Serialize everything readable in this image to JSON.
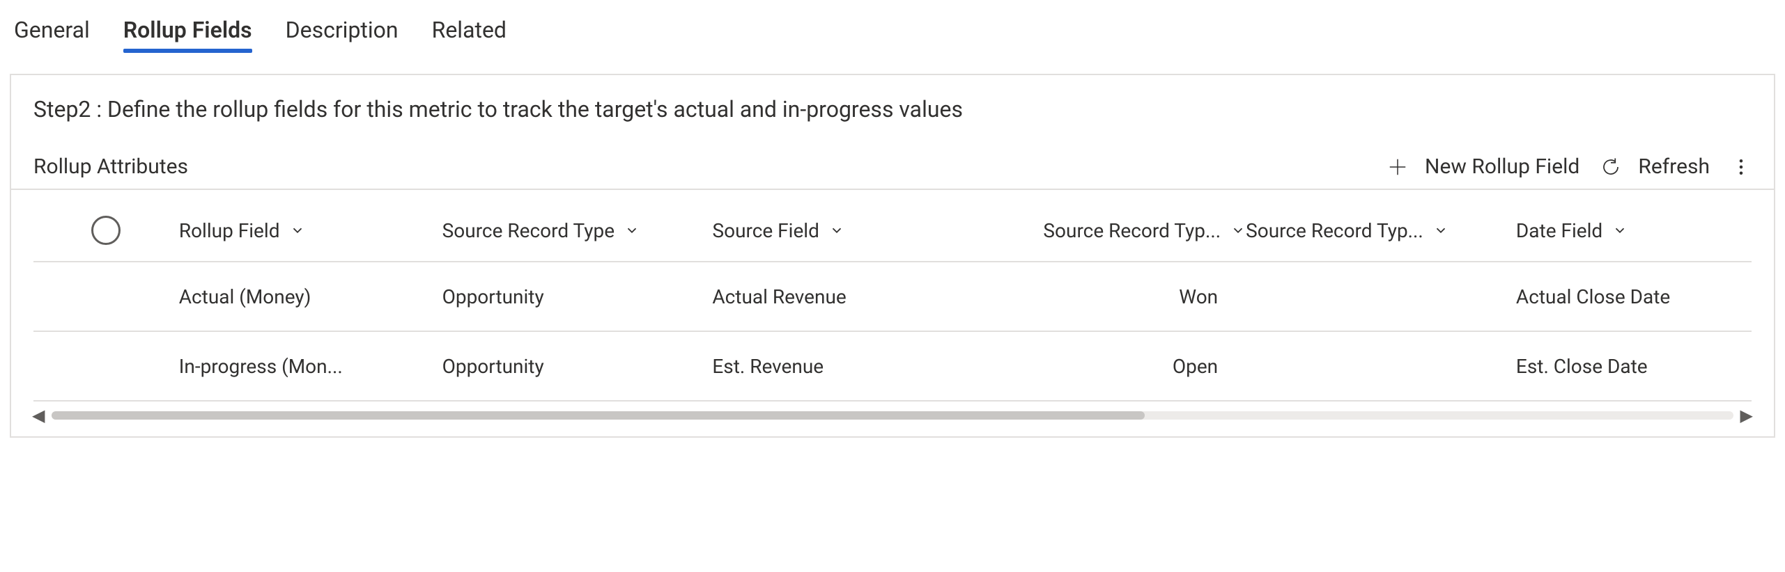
{
  "tabs": {
    "general": "General",
    "rollup_fields": "Rollup Fields",
    "description": "Description",
    "related": "Related"
  },
  "step_heading": "Step2 : Define the rollup fields for this metric to track the target's actual and in-progress values",
  "toolbar": {
    "label": "Rollup Attributes",
    "new_rollup": "New Rollup Field",
    "refresh": "Refresh"
  },
  "columns": {
    "rollup_field": "Rollup Field",
    "source_record_type": "Source Record Type",
    "source_field": "Source Field",
    "source_record_typ1": "Source Record Typ...",
    "source_record_typ2": "Source Record Typ...",
    "date_field": "Date Field"
  },
  "rows": [
    {
      "rollup_field": "Actual (Money)",
      "source_record_type": "Opportunity",
      "source_field": "Actual Revenue",
      "source_record_typ1": "Won",
      "source_record_typ2": "",
      "date_field": "Actual Close Date"
    },
    {
      "rollup_field": "In-progress (Mon...",
      "source_record_type": "Opportunity",
      "source_field": "Est. Revenue",
      "source_record_typ1": "Open",
      "source_record_typ2": "",
      "date_field": "Est. Close Date"
    }
  ]
}
